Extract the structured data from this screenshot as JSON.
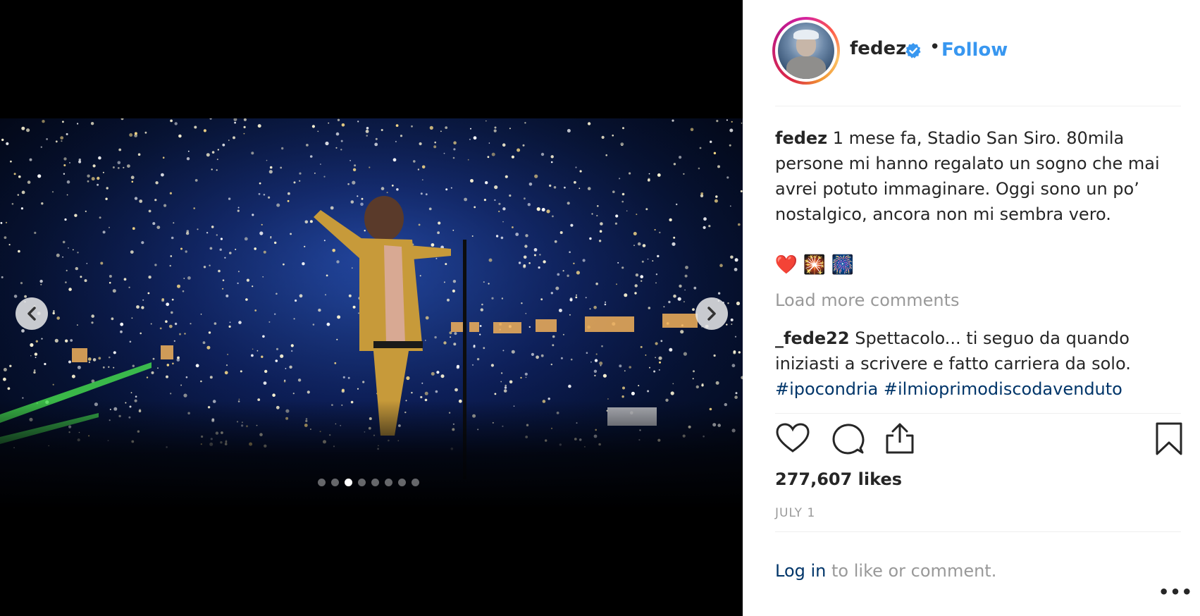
{
  "post": {
    "username": "fedez",
    "separator": "•",
    "follow_label": "Follow",
    "caption": {
      "author": "fedez",
      "text": " 1 mese fa, Stadio San Siro. 80mila persone mi hanno regalato un sogno che mai avrei potuto immaginare. Oggi sono un po’ nostalgico, ancora non mi sembra vero."
    },
    "emojis": [
      "❤️",
      "🎇",
      "🎆"
    ],
    "load_more": "Load more comments",
    "comment": {
      "author": "_fede22",
      "text": " Spettacolo... ti seguo da quando iniziasti a scrivere e fatto carriera da solo.",
      "hashtags": [
        "#ipocondria",
        "#ilmioprimodiscodavenduto"
      ]
    },
    "likes": "277,607 likes",
    "date": "JULY 1",
    "login_link": "Log in",
    "login_suffix": " to like or comment.",
    "more_label": "•••"
  },
  "carousel": {
    "prev_icon": "chevron-left-icon",
    "next_icon": "chevron-right-icon",
    "slide_count": 8,
    "active_index": 2
  },
  "colors": {
    "follow": "#3897f0",
    "link": "#003569",
    "muted": "#999999",
    "verified": "#3897f0"
  }
}
